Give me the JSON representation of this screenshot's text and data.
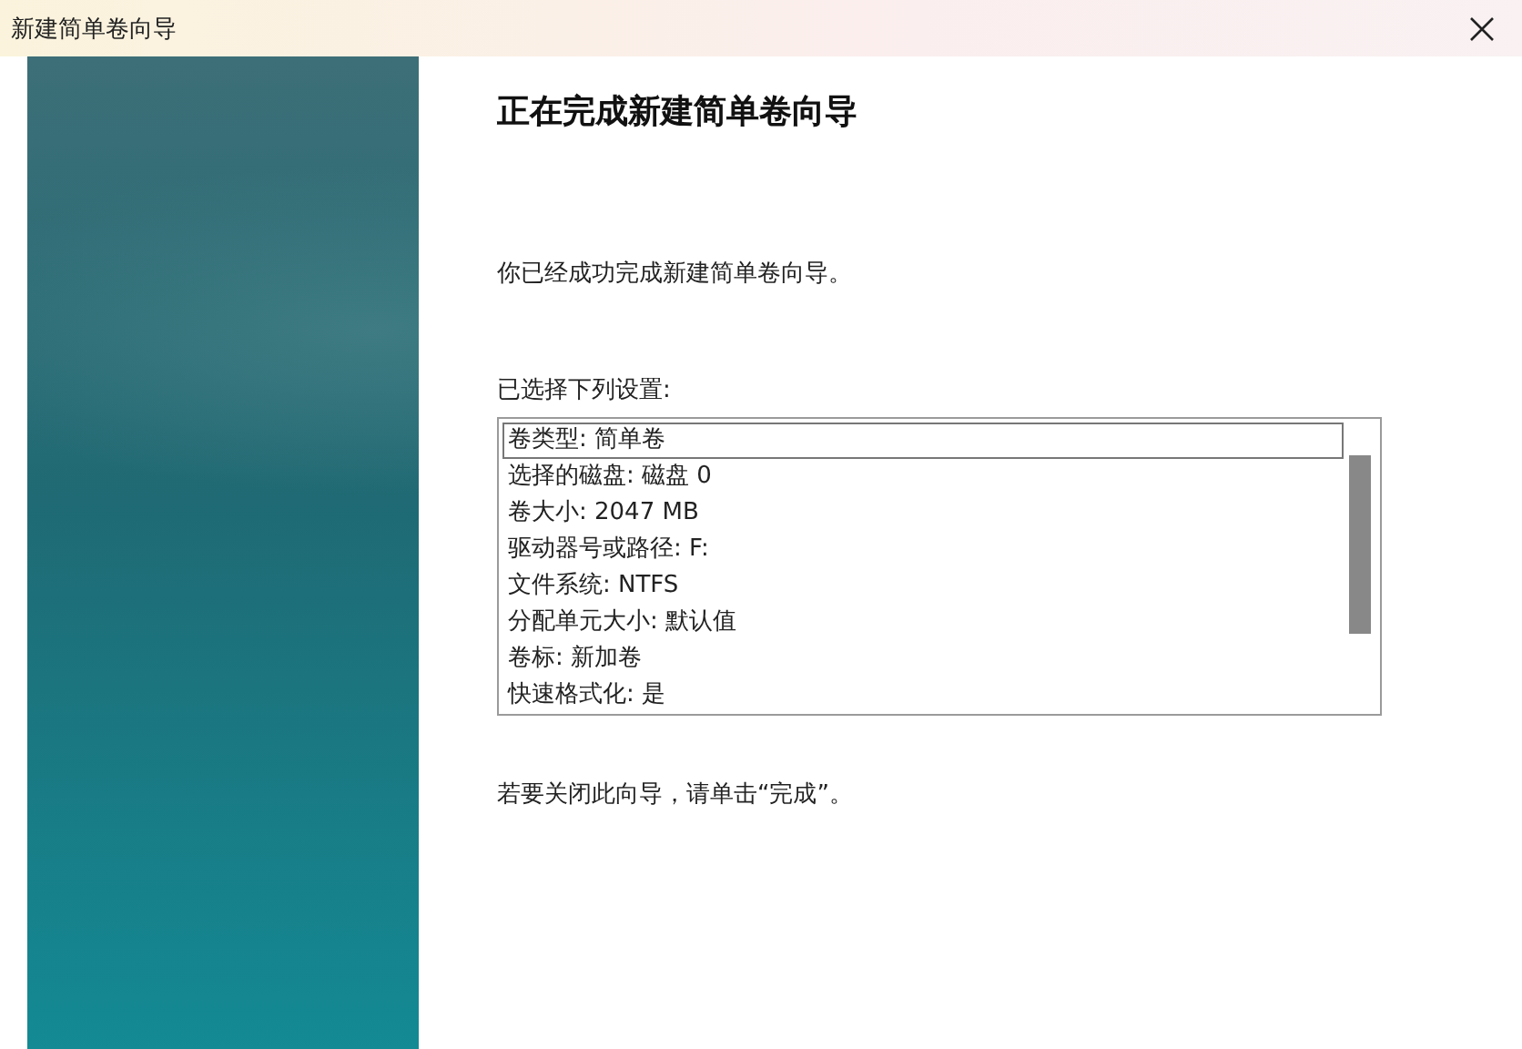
{
  "window": {
    "title": "新建简单卷向导"
  },
  "heading": "正在完成新建简单卷向导",
  "intro": "你已经成功完成新建简单卷向导。",
  "settings_label": "已选择下列设置:",
  "settings": [
    {
      "text": "卷类型: 简单卷",
      "selected": true
    },
    {
      "text": "选择的磁盘: 磁盘 0",
      "selected": false
    },
    {
      "text": "卷大小: 2047 MB",
      "selected": false
    },
    {
      "text": "驱动器号或路径: F:",
      "selected": false
    },
    {
      "text": "文件系统: NTFS",
      "selected": false
    },
    {
      "text": "分配单元大小: 默认值",
      "selected": false
    },
    {
      "text": "卷标: 新加卷",
      "selected": false
    },
    {
      "text": "快速格式化: 是",
      "selected": false
    }
  ],
  "footer": "若要关闭此向导，请单击“完成”。"
}
